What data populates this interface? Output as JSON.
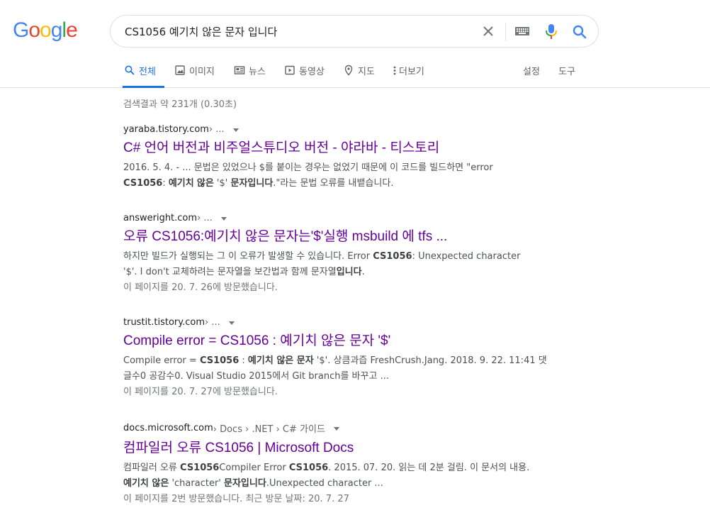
{
  "logo": {
    "letters": [
      "G",
      "o",
      "o",
      "g",
      "l",
      "e"
    ]
  },
  "search": {
    "query": "CS1056 예기치 않은 문자 입니다"
  },
  "tabs": [
    {
      "label": "전체",
      "icon": "search-icon",
      "active": true
    },
    {
      "label": "이미지",
      "icon": "image-icon"
    },
    {
      "label": "뉴스",
      "icon": "news-icon"
    },
    {
      "label": "동영상",
      "icon": "video-icon"
    },
    {
      "label": "지도",
      "icon": "map-pin-icon"
    },
    {
      "label": "더보기",
      "icon": "more-vert-icon"
    }
  ],
  "tools": {
    "settings": "설정",
    "tools": "도구"
  },
  "stats": "검색결과 약 231개 (0.30초)",
  "results": [
    {
      "site": "yaraba.tistory.com",
      "crumbs": " › ...",
      "title": "C# 언어 버전과 비주얼스튜디오 버전 - 야라바 - 티스토리",
      "snippet": [
        [
          {
            "t": "2016. 5. 4. - ... 문법은 있었으나 $를 붙이는 경우는 없었기 때문에 이 코드를 빌드하면 \"error "
          }
        ],
        [
          {
            "t": "CS1056",
            "b": true
          },
          {
            "t": ": "
          },
          {
            "t": "예기치",
            "b": true
          },
          {
            "t": " "
          },
          {
            "t": "않은",
            "b": true
          },
          {
            "t": " '$' "
          },
          {
            "t": "문자입니다",
            "b": true
          },
          {
            "t": ".\"라는 문법 오류를 내뱉습니다."
          }
        ]
      ],
      "visited": ""
    },
    {
      "site": "answeright.com",
      "crumbs": " › ...",
      "title": "오류 CS1056:예기치 않은 문자는'$'실행 msbuild 에 tfs ...",
      "snippet": [
        [
          {
            "t": "하지만 빌드가 실행되는 그 이 오류가 발생할 수 있습니다. Error "
          },
          {
            "t": "CS1056",
            "b": true
          },
          {
            "t": ": Unexpected character"
          }
        ],
        [
          {
            "t": "'$'. I don't 교체하려는 문자열을 보간법과 함께 문자열"
          },
          {
            "t": "입니다",
            "b": true
          },
          {
            "t": "."
          }
        ]
      ],
      "visited": "이 페이지를 20. 7. 26에 방문했습니다."
    },
    {
      "site": "trustit.tistory.com",
      "crumbs": " › ...",
      "title": "Compile error = CS1056 : 예기치 않은 문자 '$'",
      "snippet": [
        [
          {
            "t": "Compile error = "
          },
          {
            "t": "CS1056",
            "b": true
          },
          {
            "t": " : "
          },
          {
            "t": "예기치 않은 문자",
            "b": true
          },
          {
            "t": " '$'. 상큼과즙 FreshCrush.Jang. 2018. 9. 22. 11:41 댓"
          }
        ],
        [
          {
            "t": "글수0 공감수0. Visual Studio 2015에서 Git branch를 바꾸고 ..."
          }
        ]
      ],
      "visited": "이 페이지를 20. 7. 27에 방문했습니다."
    },
    {
      "site": "docs.microsoft.com",
      "crumbs": " › Docs › .NET › C# 가이드",
      "title": "컴파일러 오류 CS1056 | Microsoft Docs",
      "snippet": [
        [
          {
            "t": "컴파일러 오류 "
          },
          {
            "t": "CS1056",
            "b": true
          },
          {
            "t": "Compiler Error "
          },
          {
            "t": "CS1056",
            "b": true
          },
          {
            "t": ". 2015. 07. 20. 읽는 데 2분 걸림. 이 문서의 내용."
          }
        ],
        [
          {
            "t": "예기치 않은",
            "b": true
          },
          {
            "t": " 'character' "
          },
          {
            "t": "문자입니다",
            "b": true
          },
          {
            "t": ".Unexpected character ..."
          }
        ]
      ],
      "visited": "이 페이지를 2번 방문했습니다. 최근 방문 날짜: 20. 7. 27"
    }
  ],
  "colors": {
    "logo": [
      "#4285f4",
      "#ea4335",
      "#fbbc05",
      "#4285f4",
      "#34a853",
      "#ea4335"
    ],
    "link_visited": "#660099",
    "tab_active": "#1a73e8",
    "mic": [
      "#4285f4",
      "#ea4335",
      "#fbbc05",
      "#34a853"
    ]
  }
}
